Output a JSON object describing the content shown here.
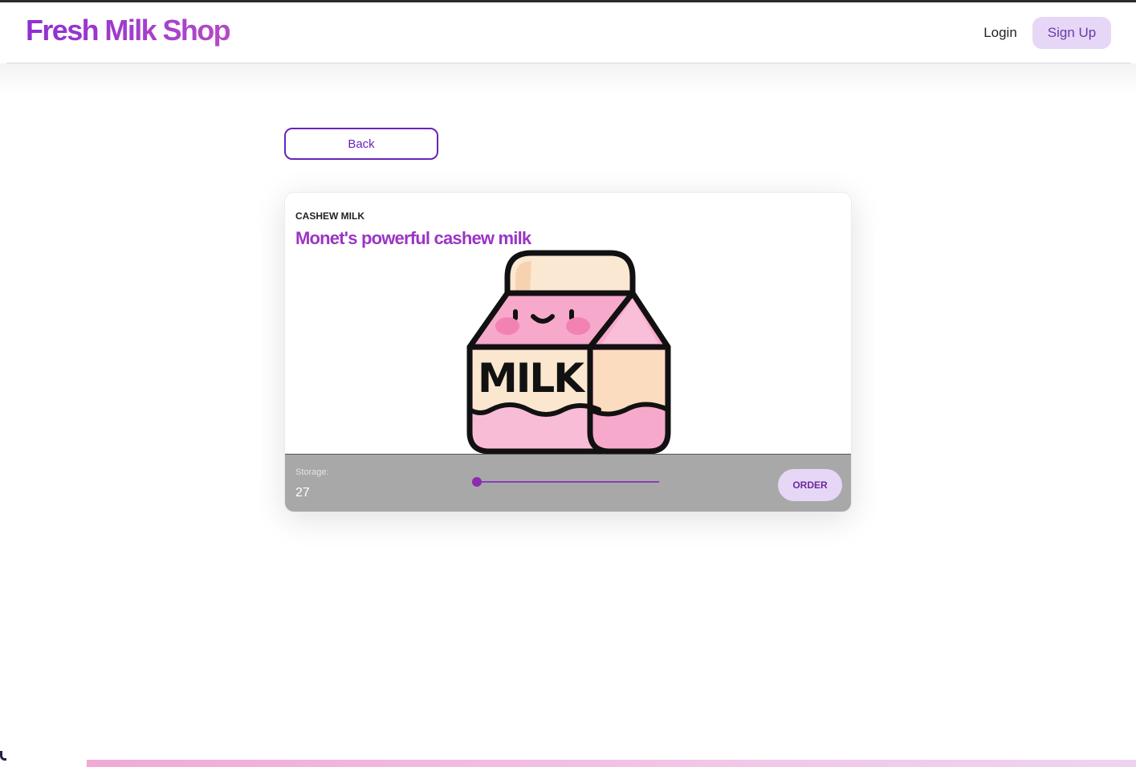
{
  "header": {
    "logo": "Fresh Milk Shop",
    "login_label": "Login",
    "signup_label": "Sign Up"
  },
  "back_label": "Back",
  "product": {
    "category": "CASHEW MILK",
    "title": "Monet's powerful cashew milk",
    "image_icon": "milk-carton-icon",
    "image_text": "MILK",
    "storage_label": "Storage:",
    "storage_value": "27",
    "order_label": "ORDER"
  },
  "colors": {
    "brand": "#9b35c4",
    "accent_light": "#e6d7f7",
    "footer_bar": "#a8a8a8"
  }
}
